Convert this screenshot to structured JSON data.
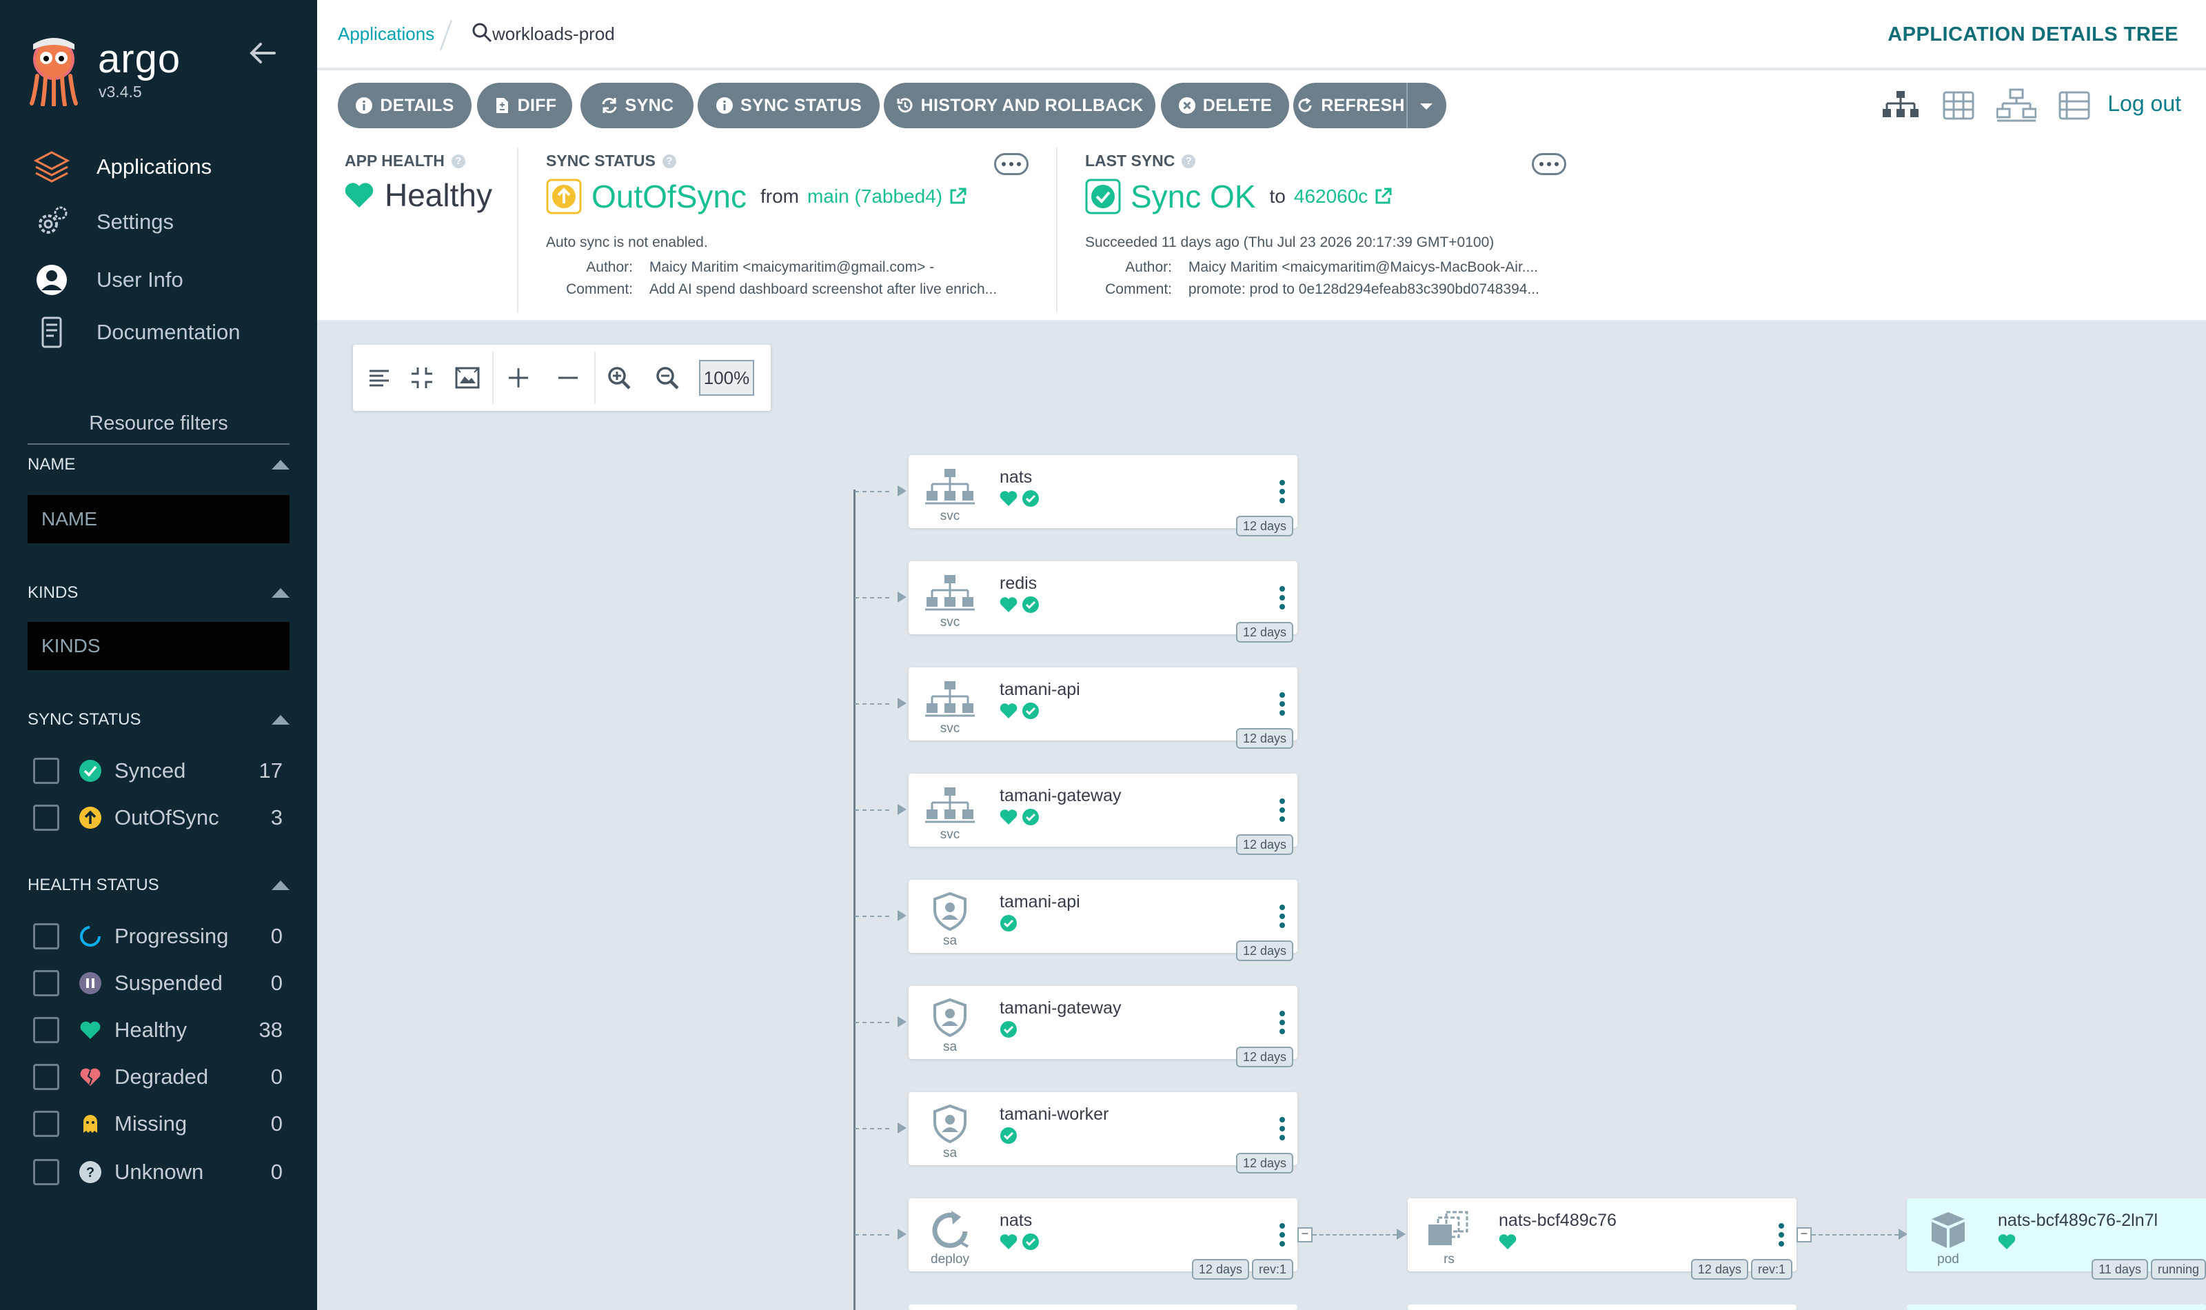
{
  "sidebar": {
    "brand": "argo",
    "version": "v3.4.5",
    "nav": [
      {
        "label": "Applications"
      },
      {
        "label": "Settings"
      },
      {
        "label": "User Info"
      },
      {
        "label": "Documentation"
      }
    ],
    "filters_title": "Resource filters",
    "name_filter": {
      "label": "NAME",
      "placeholder": "NAME"
    },
    "kinds_filter": {
      "label": "KINDS",
      "placeholder": "KINDS"
    },
    "sync_status": {
      "label": "SYNC STATUS",
      "items": [
        {
          "label": "Synced",
          "count": "17"
        },
        {
          "label": "OutOfSync",
          "count": "3"
        }
      ]
    },
    "health_status": {
      "label": "HEALTH STATUS",
      "items": [
        {
          "label": "Progressing",
          "count": "0"
        },
        {
          "label": "Suspended",
          "count": "0"
        },
        {
          "label": "Healthy",
          "count": "38"
        },
        {
          "label": "Degraded",
          "count": "0"
        },
        {
          "label": "Missing",
          "count": "0"
        },
        {
          "label": "Unknown",
          "count": "0"
        }
      ]
    }
  },
  "topbar": {
    "breadcrumb_root": "Applications",
    "app_name": "workloads-prod",
    "page_title": "APPLICATION DETAILS TREE"
  },
  "actions": {
    "details": "DETAILS",
    "diff": "DIFF",
    "sync": "SYNC",
    "sync_status": "SYNC STATUS",
    "history": "HISTORY AND ROLLBACK",
    "delete": "DELETE",
    "refresh": "REFRESH",
    "logout": "Log out"
  },
  "status": {
    "app_health": {
      "label": "APP HEALTH",
      "value": "Healthy"
    },
    "sync_status": {
      "label": "SYNC STATUS",
      "value": "OutOfSync",
      "from_word": "from",
      "revision": "main (7abbed4)",
      "note": "Auto sync is not enabled.",
      "author_key": "Author:",
      "author": "Maicy Maritim <maicymaritim@gmail.com> -",
      "comment_key": "Comment:",
      "comment": "Add AI spend dashboard screenshot after live enrich..."
    },
    "last_sync": {
      "label": "LAST SYNC",
      "value": "Sync OK",
      "to_word": "to",
      "revision": "462060c",
      "note": "Succeeded 11 days ago (Thu Jul 23 2026 20:17:39 GMT+0100)",
      "author_key": "Author:",
      "author": "Maicy Maritim <maicymaritim@Maicys-MacBook-Air....",
      "comment_key": "Comment:",
      "comment": "promote: prod to 0e128d294efeab83c390bd0748394..."
    }
  },
  "graph": {
    "zoom": "100%",
    "nodes": [
      {
        "name": "nats",
        "kind": "svc",
        "age": "12 days",
        "sync_ok": true
      },
      {
        "name": "redis",
        "kind": "svc",
        "age": "12 days",
        "sync_ok": true
      },
      {
        "name": "tamani-api",
        "kind": "svc",
        "age": "12 days",
        "sync_ok": true
      },
      {
        "name": "tamani-gateway",
        "kind": "svc",
        "age": "12 days",
        "sync_ok": true
      },
      {
        "name": "tamani-api",
        "kind": "sa",
        "age": "12 days"
      },
      {
        "name": "tamani-gateway",
        "kind": "sa",
        "age": "12 days"
      },
      {
        "name": "tamani-worker",
        "kind": "sa",
        "age": "12 days"
      },
      {
        "name": "nats",
        "kind": "deploy",
        "age": "12 days",
        "rev": "rev:1",
        "sync_ok": true
      }
    ],
    "children": [
      {
        "name": "nats-bcf489c76",
        "kind": "rs",
        "age": "12 days",
        "rev": "rev:1"
      },
      {
        "name": "nats-bcf489c76-2ln7l",
        "kind": "pod",
        "age": "11 days",
        "state": "running"
      }
    ]
  },
  "colors": {
    "sidebar": "#0f2733",
    "accent": "#00a2b3",
    "healthy": "#18be94",
    "outofsync": "#f4c030",
    "button": "#6d7f8b"
  }
}
